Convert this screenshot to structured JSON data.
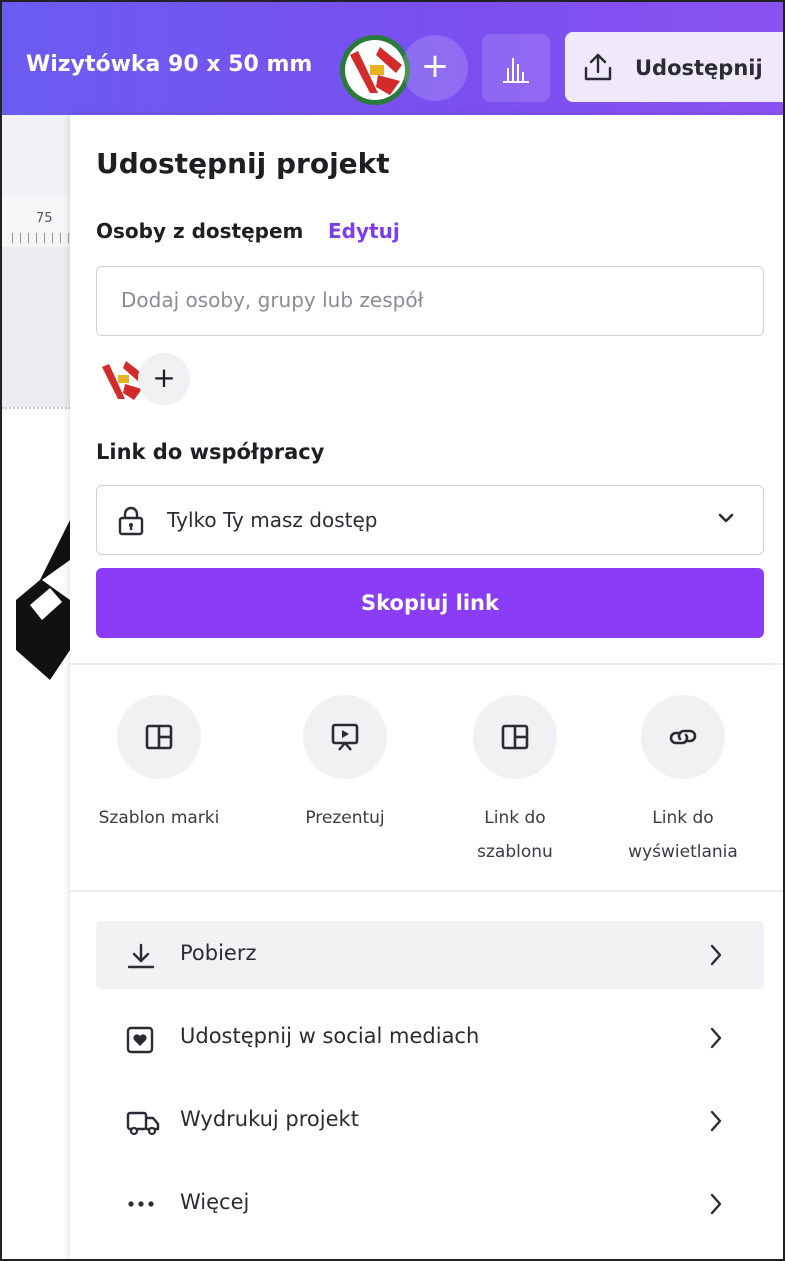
{
  "header": {
    "document_title": "Wizytówka 90 x 50 mm",
    "add_label": "+",
    "share_button_label": "Udostępnij"
  },
  "canvas": {
    "ruler_number": "75"
  },
  "share_panel": {
    "title": "Udostępnij projekt",
    "people_section_label": "Osoby z dostępem",
    "edit_link_label": "Edytuj",
    "people_input_placeholder": "Dodaj osoby, grupy lub zespół",
    "add_person_label": "+",
    "collab_link_label": "Link do współpracy",
    "access_value": "Tylko Ty masz dostęp",
    "copy_link_label": "Skopiuj link",
    "actions": [
      {
        "label": "Szablon marki",
        "icon": "layout-icon"
      },
      {
        "label": "Prezentuj",
        "icon": "present-icon"
      },
      {
        "label": "Link do szablonu",
        "icon": "layout-icon"
      },
      {
        "label": "Link do wyświetlania",
        "icon": "link-icon"
      }
    ],
    "menu": [
      {
        "label": "Pobierz",
        "icon": "download-icon"
      },
      {
        "label": "Udostępnij w social mediach",
        "icon": "heart-icon"
      },
      {
        "label": "Wydrukuj projekt",
        "icon": "truck-icon"
      },
      {
        "label": "Więcej",
        "icon": "more-icon"
      }
    ]
  },
  "colors": {
    "header_gradient_start": "#6b5cf0",
    "header_gradient_end": "#8a52f1",
    "accent_purple": "#8b3cf7",
    "edit_link": "#7d3cf0"
  }
}
